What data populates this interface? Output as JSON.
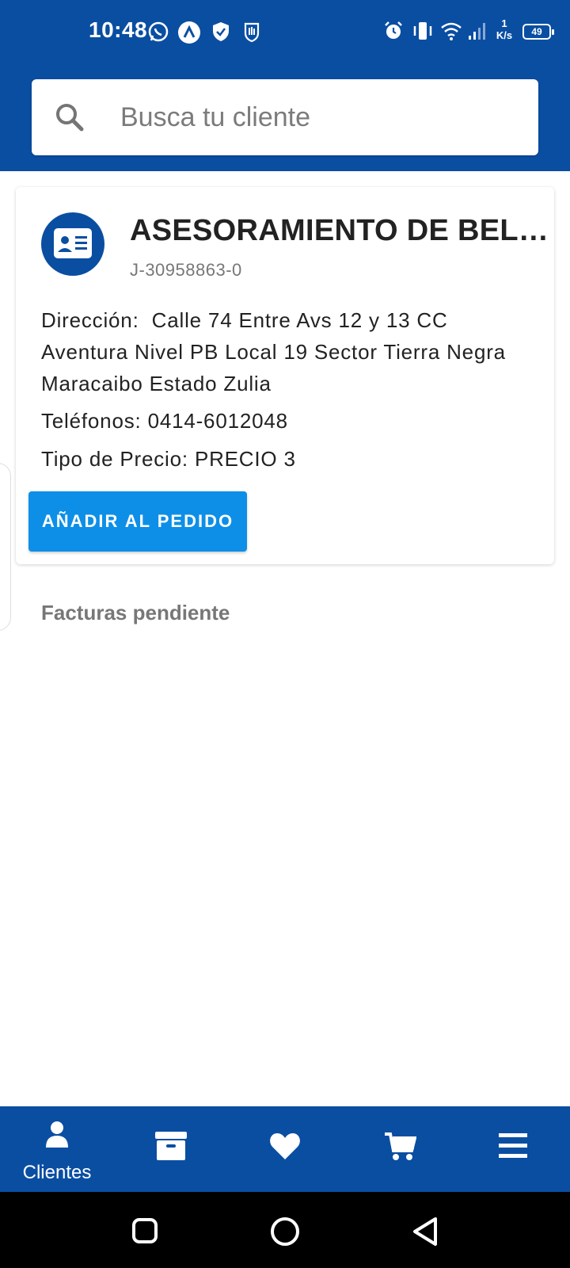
{
  "status_bar": {
    "time": "10:48",
    "speed_value": "1",
    "speed_unit": "K/s",
    "battery": "49"
  },
  "search": {
    "placeholder": "Busca tu cliente",
    "value": ""
  },
  "client": {
    "name": "ASESORAMIENTO DE BELLE...",
    "rif": "J-30958863-0",
    "address_label": "Dirección:",
    "address": "Calle 74 Entre Avs 12 y 13 CC Aventura Nivel PB Local 19 Sector Tierra Negra Maracaibo Estado Zulia",
    "phone_label": "Teléfonos:",
    "phone": "0414-6012048",
    "price_label": "Tipo de Precio:",
    "price": "PRECIO 3",
    "add_button": "AÑADIR AL PEDIDO"
  },
  "pending_title": "Facturas pendiente",
  "bottom_nav": {
    "items": [
      {
        "label": "Clientes",
        "icon": "person-icon"
      },
      {
        "label": "",
        "icon": "archive-icon"
      },
      {
        "label": "",
        "icon": "heart-icon"
      },
      {
        "label": "",
        "icon": "cart-icon"
      },
      {
        "label": "",
        "icon": "menu-icon"
      }
    ]
  },
  "colors": {
    "primary": "#0a4ea2",
    "button": "#0d8fe8"
  }
}
